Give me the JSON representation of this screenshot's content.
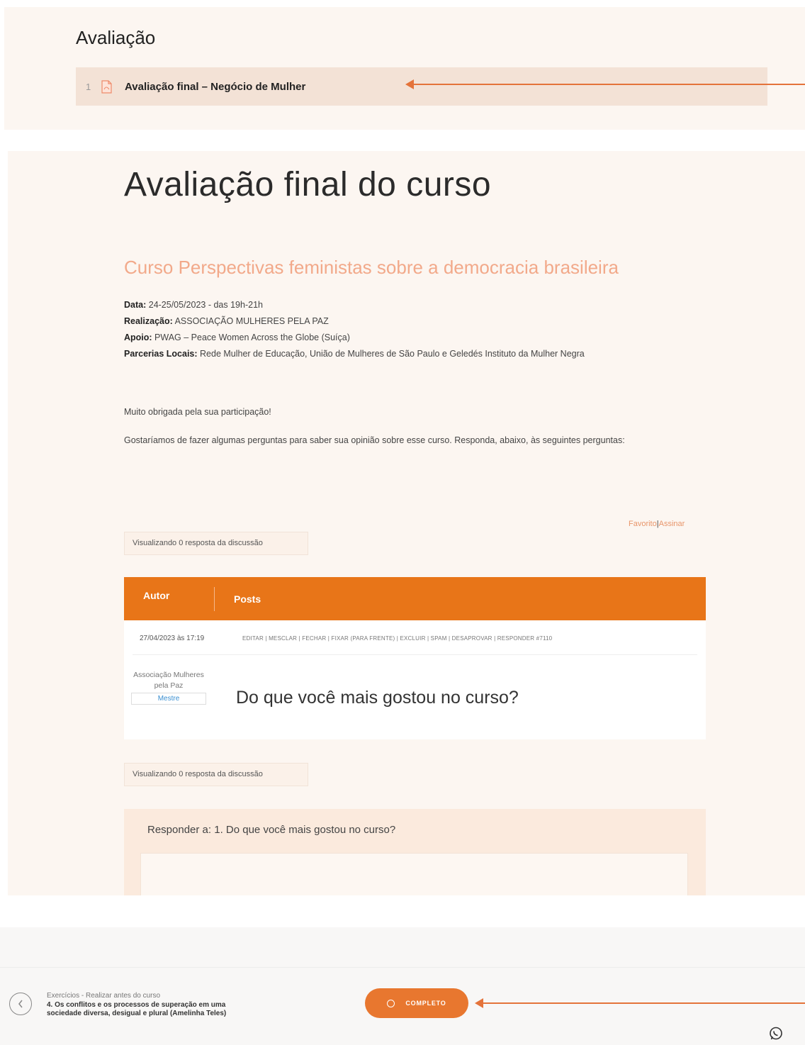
{
  "section": {
    "title": "Avaliação",
    "lesson": {
      "number": "1",
      "title": "Avaliação final – Negócio de Mulher",
      "icon": "pdf-icon"
    }
  },
  "content": {
    "page_title": "Avaliação final do curso",
    "course_title": "Curso Perspectivas feministas sobre a democracia brasileira",
    "meta": {
      "data_label": "Data:",
      "data_value": " 24-25/05/2023 - das 19h-21h",
      "realizacao_label": "Realização:",
      "realizacao_value": " ASSOCIAÇÃO MULHERES PELA PAZ",
      "apoio_label": "Apoio:",
      "apoio_value": " PWAG – Peace Women Across the Globe (Suíça)",
      "parcerias_label": "Parcerias Locais:",
      "parcerias_value": " Rede Mulher de Educação, União de Mulheres de São Paulo e Geledés Instituto da Mulher Negra"
    },
    "thanks": "Muito obrigada pela sua participação!",
    "intro": "Gostaríamos de fazer algumas perguntas para saber sua opinião sobre esse curso. Responda, abaixo, às seguintes perguntas:"
  },
  "forum": {
    "favorite": "Favorito",
    "separator": "|",
    "subscribe": "Assinar",
    "viewing_text": "Visualizando 0 resposta da discussão",
    "header_author": "Autor",
    "header_posts": "Posts",
    "post": {
      "date": "27/04/2023 às 17:19",
      "admin_links": "EDITAR | MESCLAR | FECHAR | FIXAR (PARA FRENTE) | EXCLUIR | SPAM | DESAPROVAR | RESPONDER #7110",
      "author_name": "Associação Mulheres pela Paz",
      "author_role": "Mestre",
      "question": "Do que você mais gostou no curso?"
    },
    "reply_label": "Responder a: 1. Do que você mais gostou no curso?"
  },
  "footer": {
    "prev_category": "Exercícios - Realizar antes do curso",
    "prev_title": "4. Os conflitos e os processos de superação em uma sociedade diversa, desigual e plural (Amelinha Teles)",
    "complete_label": "COMPLETO",
    "prev_icon": "chevron-left-icon",
    "whatsapp_icon": "whatsapp-icon"
  },
  "colors": {
    "accent": "#e87518",
    "arrow": "#e4733a",
    "course_title": "#f2a98a"
  }
}
